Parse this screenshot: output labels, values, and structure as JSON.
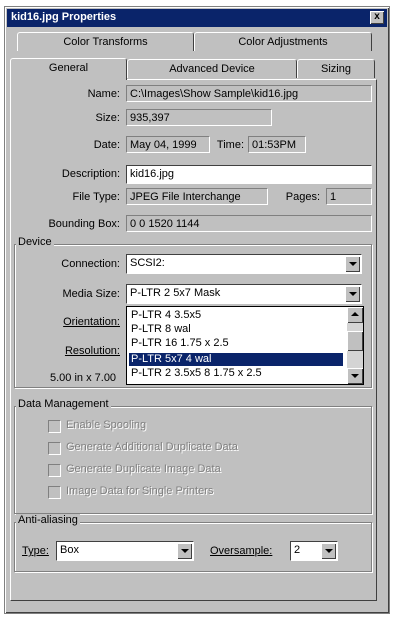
{
  "window": {
    "title": "kid16.jpg Properties",
    "close_label": "x"
  },
  "tabs": {
    "row1": [
      "Color Transforms",
      "Color Adjustments"
    ],
    "row2": [
      "General",
      "Advanced Device",
      "Sizing"
    ],
    "active": "General"
  },
  "general": {
    "name_label": "Name:",
    "name_value": "C:\\Images\\Show Sample\\kid16.jpg",
    "size_label": "Size:",
    "size_value": "935,397",
    "date_label": "Date:",
    "date_value": "May 04, 1999",
    "time_label": "Time:",
    "time_value": "01:53PM",
    "description_label": "Description:",
    "description_value": "kid16.jpg",
    "filetype_label": "File Type:",
    "filetype_value": "JPEG File Interchange",
    "pages_label": "Pages:",
    "pages_value": "1",
    "bbox_label": "Bounding Box:",
    "bbox_value": "0 0 1520 1144"
  },
  "device": {
    "title": "Device",
    "connection_label": "Connection:",
    "connection_value": "SCSI2:",
    "media_label": "Media Size:",
    "media_value": "P-LTR 2 5x7 Mask",
    "orientation_label": "Orientation:",
    "resolution_label": "Resolution:",
    "size_readout": "5.00 in x 7.00",
    "media_options": [
      "P-LTR 4 3.5x5",
      "P-LTR 8 wal",
      "P-LTR 16 1.75 x 2.5",
      "P-LTR 5x7 4 wal",
      "P-LTR 2 3.5x5 8 1.75 x 2.5"
    ],
    "media_selected_index": 3
  },
  "data_management": {
    "title": "Data Management",
    "options": [
      "Enable Spooling",
      "Generate Additional Duplicate Data",
      "Generate Duplicate Image Data",
      "Image Data for Single Printers"
    ]
  },
  "antialiasing": {
    "title": "Anti-aliasing",
    "type_label": "Type:",
    "type_value": "Box",
    "oversample_label": "Oversample:",
    "oversample_value": "2"
  },
  "colors": {
    "titlebar": "#0a246a",
    "face": "#c0c0c0",
    "selection": "#0a246a"
  }
}
